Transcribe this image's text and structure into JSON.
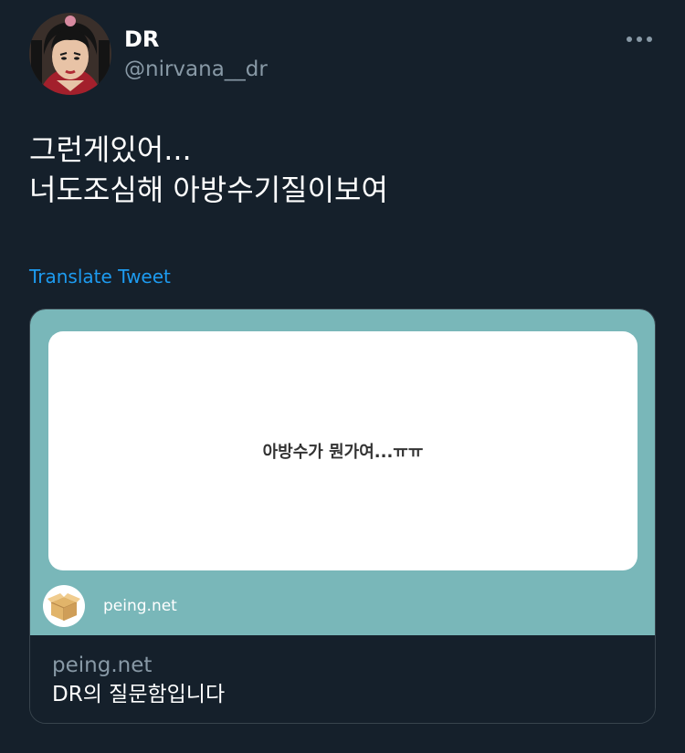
{
  "user": {
    "display_name": "DR",
    "handle": "@nirvana__dr"
  },
  "tweet": {
    "lines": [
      "그런게있어...",
      "너도조심해 아방수기질이보여"
    ]
  },
  "translate_label": "Translate Tweet",
  "card": {
    "question": "아방수가 뭔가여...ㅠㅠ",
    "site_name": "peing.net",
    "domain": "peing.net",
    "title": "DR의 질문함입니다",
    "media_color": "#79b7b9"
  },
  "icons": {
    "more": "more-horizontal-icon",
    "site_logo": "cardboard-box-icon"
  },
  "colors": {
    "background": "#15202b",
    "link": "#1d9bf0",
    "secondary_text": "#8899a6"
  }
}
